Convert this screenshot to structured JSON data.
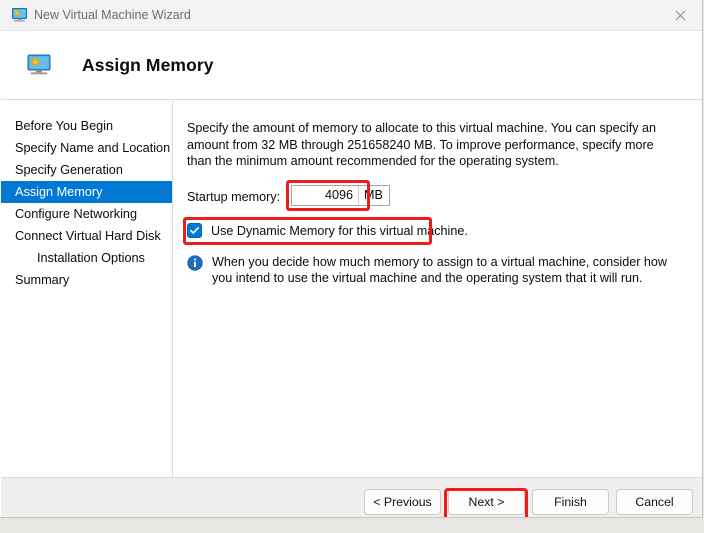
{
  "window": {
    "title": "New Virtual Machine Wizard",
    "title_icon": "virtual-machine-icon",
    "close_label": "✕"
  },
  "header": {
    "icon": "virtual-machine-icon",
    "title": "Assign Memory"
  },
  "sidebar": {
    "items": [
      {
        "label": "Before You Begin",
        "selected": false,
        "indent": false
      },
      {
        "label": "Specify Name and Location",
        "selected": false,
        "indent": false
      },
      {
        "label": "Specify Generation",
        "selected": false,
        "indent": false
      },
      {
        "label": "Assign Memory",
        "selected": true,
        "indent": false
      },
      {
        "label": "Configure Networking",
        "selected": false,
        "indent": false
      },
      {
        "label": "Connect Virtual Hard Disk",
        "selected": false,
        "indent": false
      },
      {
        "label": "Installation Options",
        "selected": false,
        "indent": true
      },
      {
        "label": "Summary",
        "selected": false,
        "indent": false
      }
    ],
    "selected_bg": "#0078d4"
  },
  "content": {
    "intro": "Specify the amount of memory to allocate to this virtual machine. You can specify an amount from 32 MB through 251658240 MB. To improve performance, specify more than the minimum amount recommended for the operating system.",
    "startup_memory_label": "Startup memory:",
    "startup_memory_value": "4096",
    "startup_memory_unit": "MB",
    "dynamic_memory_label": "Use Dynamic Memory for this virtual machine.",
    "dynamic_memory_checked": true,
    "note_icon": "info-icon",
    "note_text": "When you decide how much memory to assign to a virtual machine, consider how you intend to use the virtual machine and the operating system that it will run."
  },
  "footer": {
    "previous_label": "< Previous",
    "next_label": "Next >",
    "finish_label": "Finish",
    "cancel_label": "Cancel"
  },
  "annotations": {
    "color": "#ee1c1c",
    "targets": [
      "startup-memory-field",
      "dynamic-memory-checkbox-row",
      "next-button"
    ]
  },
  "background": {
    "strip_text": " "
  }
}
